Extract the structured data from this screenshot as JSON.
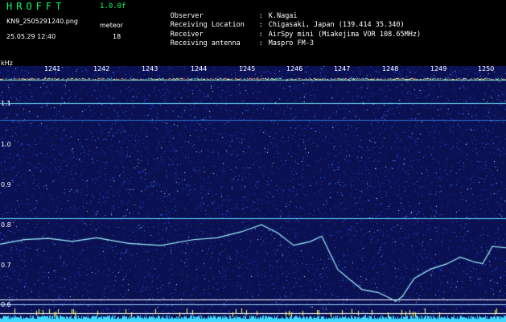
{
  "header": {
    "app_title": "HROFFT",
    "app_version": "1.0.0f",
    "filename": "KN9_2505291240.png",
    "datetime": "25.05.29 12:40",
    "meteor_label": "meteor",
    "meteor_count": "18"
  },
  "info": [
    {
      "key": "Observer",
      "value": "K.Nagai"
    },
    {
      "key": "Receiving Location",
      "value": "Chigasaki, Japan (139.414 35.340)"
    },
    {
      "key": "Receiver",
      "value": "AirSpy mini (Miakejima VOR 108.65MHz)"
    },
    {
      "key": "Receiving antenna",
      "value": "Maspro FM-3"
    }
  ],
  "axes": {
    "y_unit": "kHz",
    "y_ticks": [
      "1.1",
      "1.0",
      "0.9",
      "0.8",
      "0.7",
      "0.6"
    ],
    "x_ticks": [
      "1241",
      "1242",
      "1243",
      "1244",
      "1245",
      "1246",
      "1247",
      "1248",
      "1249",
      "1250"
    ]
  },
  "colors": {
    "background": "#000000",
    "waterfall_base": "#0a1050",
    "title_green": "#00ff66",
    "trace": "#9ff0ff"
  }
}
